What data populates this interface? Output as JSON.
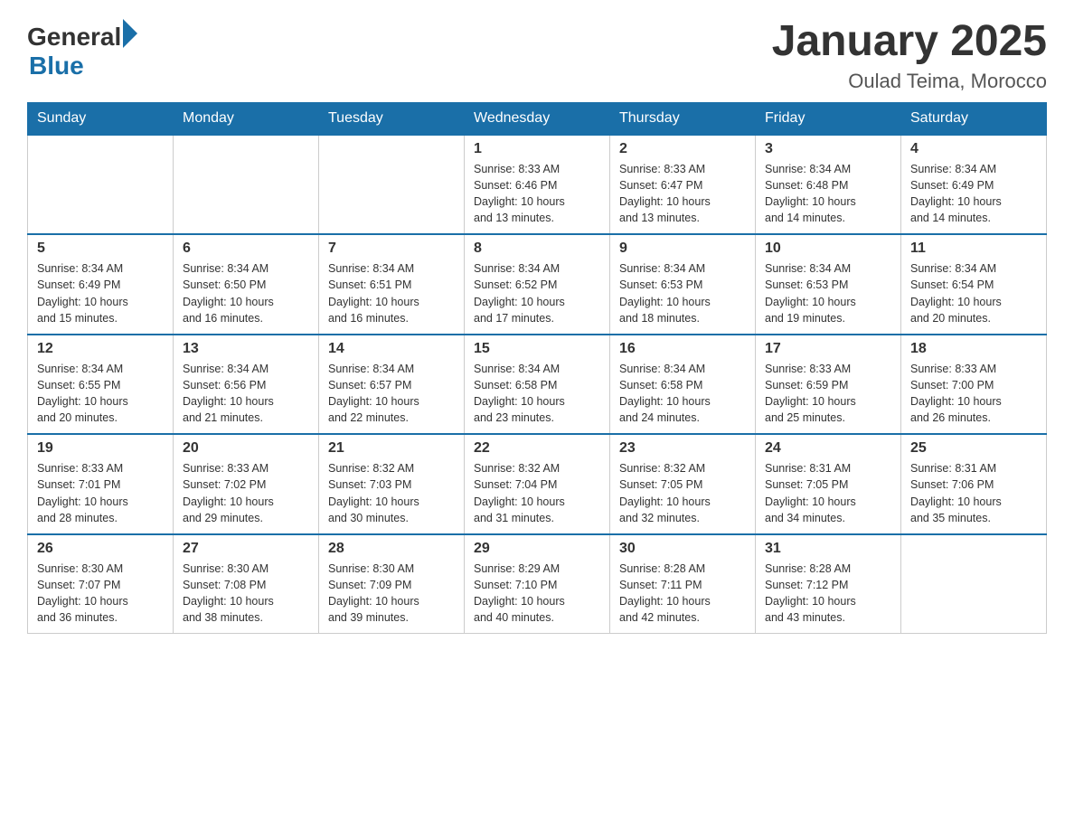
{
  "header": {
    "logo_general": "General",
    "logo_blue": "Blue",
    "title": "January 2025",
    "subtitle": "Oulad Teima, Morocco"
  },
  "days_of_week": [
    "Sunday",
    "Monday",
    "Tuesday",
    "Wednesday",
    "Thursday",
    "Friday",
    "Saturday"
  ],
  "weeks": [
    [
      {
        "day": "",
        "info": ""
      },
      {
        "day": "",
        "info": ""
      },
      {
        "day": "",
        "info": ""
      },
      {
        "day": "1",
        "info": "Sunrise: 8:33 AM\nSunset: 6:46 PM\nDaylight: 10 hours\nand 13 minutes."
      },
      {
        "day": "2",
        "info": "Sunrise: 8:33 AM\nSunset: 6:47 PM\nDaylight: 10 hours\nand 13 minutes."
      },
      {
        "day": "3",
        "info": "Sunrise: 8:34 AM\nSunset: 6:48 PM\nDaylight: 10 hours\nand 14 minutes."
      },
      {
        "day": "4",
        "info": "Sunrise: 8:34 AM\nSunset: 6:49 PM\nDaylight: 10 hours\nand 14 minutes."
      }
    ],
    [
      {
        "day": "5",
        "info": "Sunrise: 8:34 AM\nSunset: 6:49 PM\nDaylight: 10 hours\nand 15 minutes."
      },
      {
        "day": "6",
        "info": "Sunrise: 8:34 AM\nSunset: 6:50 PM\nDaylight: 10 hours\nand 16 minutes."
      },
      {
        "day": "7",
        "info": "Sunrise: 8:34 AM\nSunset: 6:51 PM\nDaylight: 10 hours\nand 16 minutes."
      },
      {
        "day": "8",
        "info": "Sunrise: 8:34 AM\nSunset: 6:52 PM\nDaylight: 10 hours\nand 17 minutes."
      },
      {
        "day": "9",
        "info": "Sunrise: 8:34 AM\nSunset: 6:53 PM\nDaylight: 10 hours\nand 18 minutes."
      },
      {
        "day": "10",
        "info": "Sunrise: 8:34 AM\nSunset: 6:53 PM\nDaylight: 10 hours\nand 19 minutes."
      },
      {
        "day": "11",
        "info": "Sunrise: 8:34 AM\nSunset: 6:54 PM\nDaylight: 10 hours\nand 20 minutes."
      }
    ],
    [
      {
        "day": "12",
        "info": "Sunrise: 8:34 AM\nSunset: 6:55 PM\nDaylight: 10 hours\nand 20 minutes."
      },
      {
        "day": "13",
        "info": "Sunrise: 8:34 AM\nSunset: 6:56 PM\nDaylight: 10 hours\nand 21 minutes."
      },
      {
        "day": "14",
        "info": "Sunrise: 8:34 AM\nSunset: 6:57 PM\nDaylight: 10 hours\nand 22 minutes."
      },
      {
        "day": "15",
        "info": "Sunrise: 8:34 AM\nSunset: 6:58 PM\nDaylight: 10 hours\nand 23 minutes."
      },
      {
        "day": "16",
        "info": "Sunrise: 8:34 AM\nSunset: 6:58 PM\nDaylight: 10 hours\nand 24 minutes."
      },
      {
        "day": "17",
        "info": "Sunrise: 8:33 AM\nSunset: 6:59 PM\nDaylight: 10 hours\nand 25 minutes."
      },
      {
        "day": "18",
        "info": "Sunrise: 8:33 AM\nSunset: 7:00 PM\nDaylight: 10 hours\nand 26 minutes."
      }
    ],
    [
      {
        "day": "19",
        "info": "Sunrise: 8:33 AM\nSunset: 7:01 PM\nDaylight: 10 hours\nand 28 minutes."
      },
      {
        "day": "20",
        "info": "Sunrise: 8:33 AM\nSunset: 7:02 PM\nDaylight: 10 hours\nand 29 minutes."
      },
      {
        "day": "21",
        "info": "Sunrise: 8:32 AM\nSunset: 7:03 PM\nDaylight: 10 hours\nand 30 minutes."
      },
      {
        "day": "22",
        "info": "Sunrise: 8:32 AM\nSunset: 7:04 PM\nDaylight: 10 hours\nand 31 minutes."
      },
      {
        "day": "23",
        "info": "Sunrise: 8:32 AM\nSunset: 7:05 PM\nDaylight: 10 hours\nand 32 minutes."
      },
      {
        "day": "24",
        "info": "Sunrise: 8:31 AM\nSunset: 7:05 PM\nDaylight: 10 hours\nand 34 minutes."
      },
      {
        "day": "25",
        "info": "Sunrise: 8:31 AM\nSunset: 7:06 PM\nDaylight: 10 hours\nand 35 minutes."
      }
    ],
    [
      {
        "day": "26",
        "info": "Sunrise: 8:30 AM\nSunset: 7:07 PM\nDaylight: 10 hours\nand 36 minutes."
      },
      {
        "day": "27",
        "info": "Sunrise: 8:30 AM\nSunset: 7:08 PM\nDaylight: 10 hours\nand 38 minutes."
      },
      {
        "day": "28",
        "info": "Sunrise: 8:30 AM\nSunset: 7:09 PM\nDaylight: 10 hours\nand 39 minutes."
      },
      {
        "day": "29",
        "info": "Sunrise: 8:29 AM\nSunset: 7:10 PM\nDaylight: 10 hours\nand 40 minutes."
      },
      {
        "day": "30",
        "info": "Sunrise: 8:28 AM\nSunset: 7:11 PM\nDaylight: 10 hours\nand 42 minutes."
      },
      {
        "day": "31",
        "info": "Sunrise: 8:28 AM\nSunset: 7:12 PM\nDaylight: 10 hours\nand 43 minutes."
      },
      {
        "day": "",
        "info": ""
      }
    ]
  ]
}
